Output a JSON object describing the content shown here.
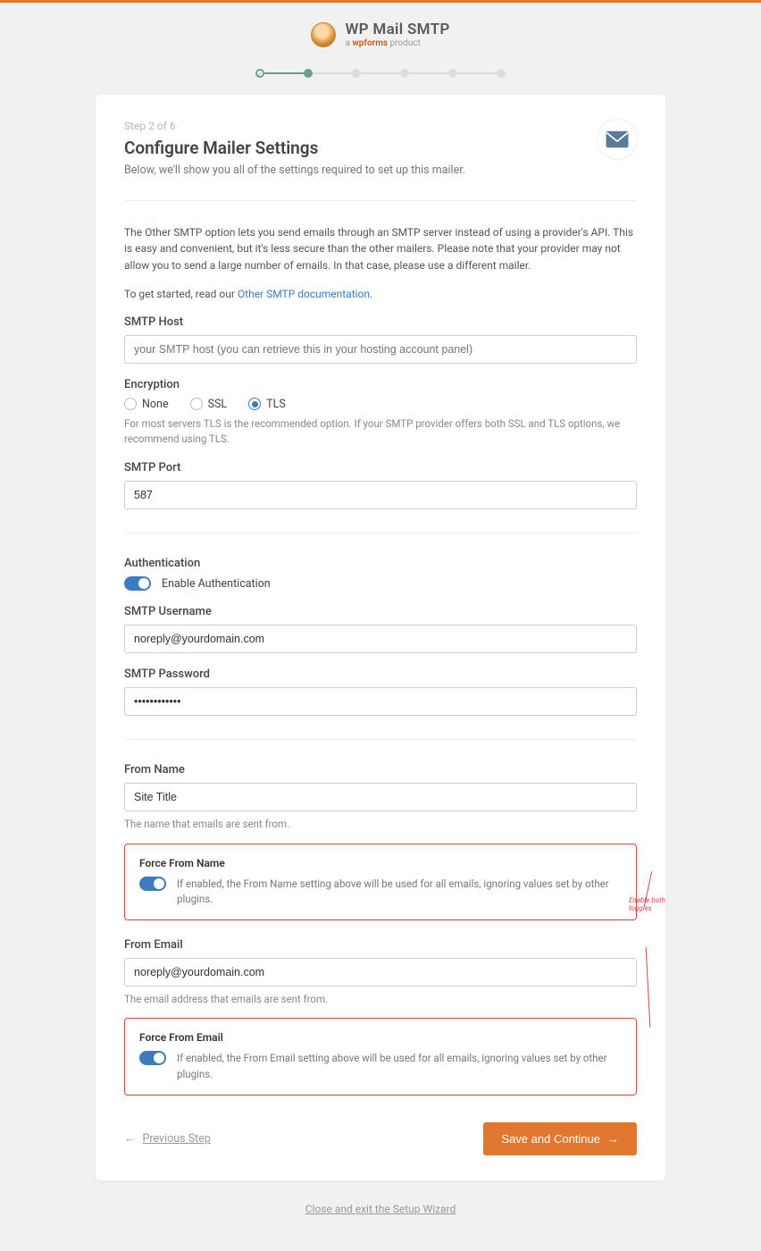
{
  "header": {
    "title": "WP Mail SMTP",
    "subtitle_prefix": "a ",
    "subtitle_brand": "wpforms",
    "subtitle_suffix": " product"
  },
  "wizard": {
    "step_label": "Step 2 of 6",
    "title": "Configure Mailer Settings",
    "subtitle": "Below, we'll show you all of the settings required to set up this mailer."
  },
  "intro": {
    "paragraph": "The Other SMTP option lets you send emails through an SMTP server instead of using a provider's API. This is easy and convenient, but it's less secure than the other mailers. Please note that your provider may not allow you to send a large number of emails. In that case, please use a different mailer.",
    "get_started_prefix": "To get started, read our ",
    "doc_link_text": "Other SMTP documentation",
    "get_started_suffix": "."
  },
  "smtp_host": {
    "label": "SMTP Host",
    "placeholder": "your SMTP host (you can retrieve this in your hosting account panel)"
  },
  "encryption": {
    "label": "Encryption",
    "options": {
      "none": "None",
      "ssl": "SSL",
      "tls": "TLS"
    },
    "hint": "For most servers TLS is the recommended option. If your SMTP provider offers both SSL and TLS options, we recommend using TLS."
  },
  "port": {
    "label": "SMTP Port",
    "value": "587"
  },
  "auth": {
    "label": "Authentication",
    "toggle_label": "Enable Authentication"
  },
  "username": {
    "label": "SMTP Username",
    "value": "noreply@yourdomain.com"
  },
  "password": {
    "label": "SMTP Password",
    "value": "••••••••••••"
  },
  "from_name": {
    "label": "From Name",
    "value": "Site Title",
    "hint": "The name that emails are sent from."
  },
  "force_from_name": {
    "title": "Force From Name",
    "desc": "If enabled, the From Name setting above will be used for all emails, ignoring values set by other plugins."
  },
  "from_email": {
    "label": "From Email",
    "value": "noreply@yourdomain.com",
    "hint": "The email address that emails are sent from."
  },
  "force_from_email": {
    "title": "Force From Email",
    "desc": "If enabled, the From Email setting above will be used for all emails, ignoring values set by other plugins."
  },
  "annotation": "Enable both toggles",
  "footer": {
    "prev": "Previous Step",
    "next": "Save and Continue",
    "exit": "Close and exit the Setup Wizard"
  }
}
